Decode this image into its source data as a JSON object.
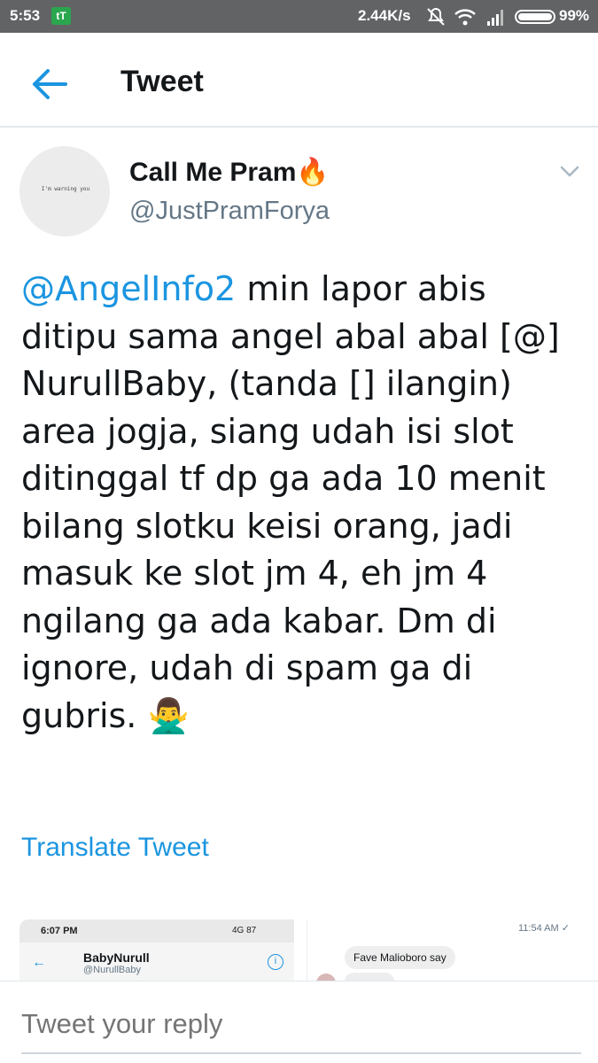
{
  "status_bar": {
    "time": "5:53",
    "app_badge": "tT",
    "network_speed": "2.44K/s",
    "battery_percent": "99%",
    "battery_level": 0.99,
    "icons": [
      "mute-icon",
      "wifi-icon",
      "signal-icon",
      "battery-icon"
    ]
  },
  "header": {
    "title": "Tweet",
    "back_icon": "arrow-left-icon"
  },
  "tweet": {
    "avatar_text": "I'm warning you",
    "display_name": "Call Me Pram",
    "name_emoji": "🔥",
    "handle": "@JustPramForya",
    "mention": "@AngelInfo2",
    "body": " min lapor abis ditipu sama angel abal abal [@] NurullBaby, (tanda [] ilangin) area jogja, siang udah isi slot ditinggal tf dp ga ada 10 menit  bilang slotku keisi orang, jadi masuk ke slot jm 4, eh jm 4 ngilang ga ada kabar. Dm di ignore, udah di spam ga di gubris. ",
    "end_emoji": "🙅‍♂️",
    "translate_label": "Translate Tweet"
  },
  "media": {
    "left": {
      "time": "6:07 PM",
      "network": "4G 87",
      "name": "BabyNurull",
      "handle": "@NurullBaby"
    },
    "right": {
      "time": "11:54 AM ✓",
      "message": "Fave Malioboro say"
    }
  },
  "reply": {
    "placeholder": "Tweet your reply"
  },
  "colors": {
    "accent": "#1b95e0",
    "status_bar": "#616365",
    "secondary_text": "#657786"
  }
}
